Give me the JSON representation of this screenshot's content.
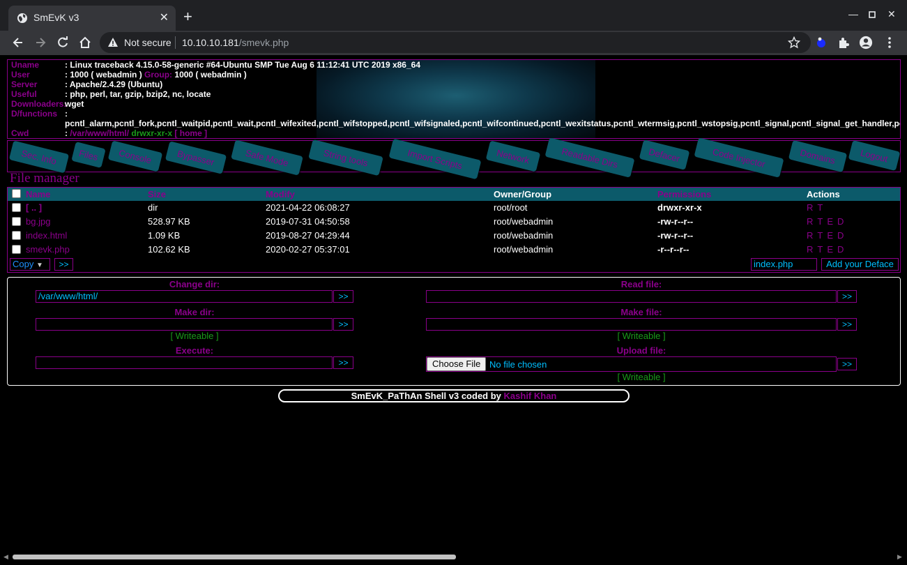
{
  "browser": {
    "tab_title": "SmEvK v3",
    "security_label": "Not secure",
    "url_host": "10.10.10.181",
    "url_path": "/smevk.php"
  },
  "sysinfo": {
    "uname_label": "Uname",
    "uname_value": ": Linux traceback 4.15.0-58-generic #64-Ubuntu SMP Tue Aug 6 11:12:41 UTC 2019 x86_64",
    "user_label": "User",
    "user_value": ": 1000 ( webadmin )",
    "group_label": "Group:",
    "group_value": "1000 ( webadmin )",
    "server_label": "Server",
    "server_value": ": Apache/2.4.29 (Ubuntu)",
    "useful_label": "Useful",
    "useful_value": ": php, perl, tar, gzip, bzip2, nc, locate",
    "downloaders_label": "Downloaders:",
    "downloaders_value": "wget",
    "dfunctions_label": "D/functions",
    "dfunctions_colon": ":",
    "dfunctions_value": "pcntl_alarm,pcntl_fork,pcntl_waitpid,pcntl_wait,pcntl_wifexited,pcntl_wifstopped,pcntl_wifsignaled,pcntl_wifcontinued,pcntl_wexitstatus,pcntl_wtermsig,pcntl_wstopsig,pcntl_signal,pcntl_signal_get_handler,pcntl_signal_dispatch",
    "cwd_label": "Cwd",
    "cwd_colon": ":",
    "cwd_path": "/var/www/html/",
    "cwd_perms": "drwxr-xr-x",
    "cwd_home": "[ home ]"
  },
  "menu": [
    "Sec. Info",
    "Files",
    "Console",
    "Bypasser",
    "Safe Mode",
    "String tools",
    "Import Scripts",
    "Network",
    "Readable Dirs",
    "Defacer",
    "Code Injector",
    "Domains",
    "Logout"
  ],
  "file_manager": {
    "title": "File manager",
    "columns": [
      "Name",
      "Size",
      "Modify",
      "Owner/Group",
      "Permissions",
      "Actions"
    ],
    "rows": [
      {
        "name": "[ .. ]",
        "size": "dir",
        "modify": "2021-04-22 06:08:27",
        "owner": "root/root",
        "perms": "drwxr-xr-x",
        "actions": [
          "R",
          "T"
        ]
      },
      {
        "name": "bg.jpg",
        "size": "528.97 KB",
        "modify": "2019-07-31 04:50:58",
        "owner": "root/webadmin",
        "perms": "-rw-r--r--",
        "actions": [
          "R",
          "T",
          "E",
          "D"
        ]
      },
      {
        "name": "index.html",
        "size": "1.09 KB",
        "modify": "2019-08-27 04:29:44",
        "owner": "root/webadmin",
        "perms": "-rw-r--r--",
        "actions": [
          "R",
          "T",
          "E",
          "D"
        ]
      },
      {
        "name": "smevk.php",
        "size": "102.62 KB",
        "modify": "2020-02-27 05:37:01",
        "owner": "root/webadmin",
        "perms": "-r--r--r--",
        "actions": [
          "R",
          "T",
          "E",
          "D"
        ]
      }
    ],
    "bulk_action": "Copy",
    "go_label": ">>",
    "deface_file": "index.php",
    "deface_button": "Add your Deface"
  },
  "tools": {
    "change_dir_label": "Change dir:",
    "change_dir_value": "/var/www/html/",
    "read_file_label": "Read file:",
    "make_dir_label": "Make dir:",
    "make_file_label": "Make file:",
    "writeable": "[ Writeable ]",
    "execute_label": "Execute:",
    "upload_label": "Upload file:",
    "choose_file": "Choose File",
    "no_file": "No file chosen",
    "go_label": ">>"
  },
  "footer": {
    "text": "SmEvK_PaThAn Shell v3 coded by",
    "author": "Kashif Khan"
  }
}
